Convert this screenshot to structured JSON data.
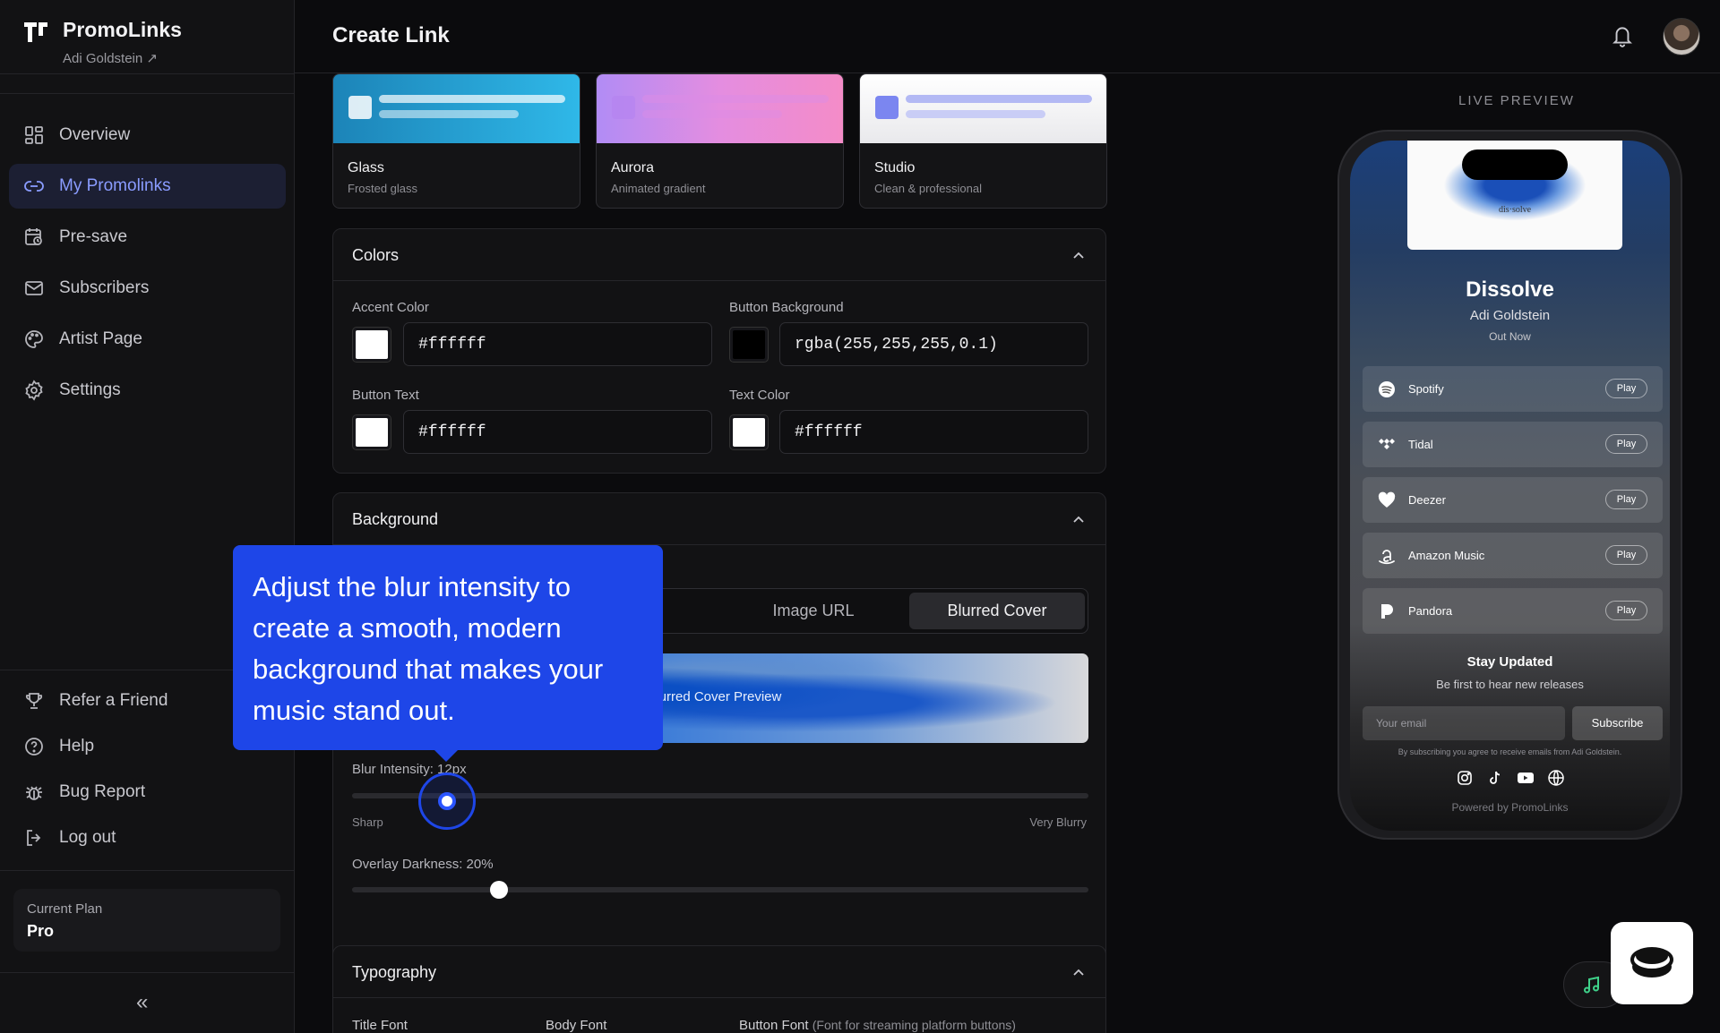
{
  "brand": {
    "name": "PromoLinks",
    "user": "Adi Goldstein ↗"
  },
  "nav": {
    "items": [
      {
        "label": "Overview",
        "icon": "grid-icon",
        "active": false
      },
      {
        "label": "My Promolinks",
        "icon": "link-icon",
        "active": true
      },
      {
        "label": "Pre-save",
        "icon": "calendar-clock-icon",
        "active": false
      },
      {
        "label": "Subscribers",
        "icon": "mail-icon",
        "active": false
      },
      {
        "label": "Artist Page",
        "icon": "palette-icon",
        "active": false
      },
      {
        "label": "Settings",
        "icon": "gear-icon",
        "active": false
      }
    ],
    "secondary": [
      {
        "label": "Refer a Friend",
        "icon": "trophy-icon"
      },
      {
        "label": "Help",
        "icon": "help-icon"
      },
      {
        "label": "Bug Report",
        "icon": "bug-icon"
      },
      {
        "label": "Log out",
        "icon": "logout-icon"
      }
    ]
  },
  "plan": {
    "label": "Current Plan",
    "value": "Pro"
  },
  "collapse_glyph": "«",
  "header": {
    "title": "Create Link"
  },
  "themes": [
    {
      "name": "Glass",
      "desc": "Frosted glass"
    },
    {
      "name": "Aurora",
      "desc": "Animated gradient"
    },
    {
      "name": "Studio",
      "desc": "Clean & professional"
    }
  ],
  "colors": {
    "title": "Colors",
    "accent": {
      "label": "Accent Color",
      "value": "#ffffff",
      "swatch": "#ffffff"
    },
    "button_bg": {
      "label": "Button Background",
      "value": "rgba(255,255,255,0.1)",
      "swatch": "#000000"
    },
    "button_text": {
      "label": "Button Text",
      "value": "#ffffff",
      "swatch": "#ffffff"
    },
    "text_color": {
      "label": "Text Color",
      "value": "#ffffff",
      "swatch": "#ffffff"
    }
  },
  "background": {
    "title": "Background",
    "options": [
      "Image URL",
      "Blurred Cover"
    ],
    "selected": "Blurred Cover",
    "preview_text": "urred Cover Preview",
    "blur": {
      "label": "Blur Intensity: 12px",
      "min_label": "Sharp",
      "max_label": "Very Blurry",
      "value_fraction": 0.13
    },
    "overlay": {
      "label": "Overlay Darkness: 20%",
      "value_fraction": 0.2
    }
  },
  "typography": {
    "title": "Typography",
    "title_font": "Title Font",
    "body_font": "Body Font",
    "button_font": "Button Font",
    "button_font_hint": "(Font for streaming platform buttons)"
  },
  "tooltip": {
    "text": "Adjust the blur intensity to create a smooth, modern background that makes your music stand out."
  },
  "preview": {
    "label": "LIVE PREVIEW",
    "cover_text": "dis·solve",
    "title": "Dissolve",
    "artist": "Adi Goldstein",
    "status": "Out Now",
    "services": [
      {
        "name": "Spotify",
        "icon": "spotify-icon",
        "cta": "Play"
      },
      {
        "name": "Tidal",
        "icon": "tidal-icon",
        "cta": "Play"
      },
      {
        "name": "Deezer",
        "icon": "deezer-icon",
        "cta": "Play"
      },
      {
        "name": "Amazon Music",
        "icon": "amazon-icon",
        "cta": "Play"
      },
      {
        "name": "Pandora",
        "icon": "pandora-icon",
        "cta": "Play"
      }
    ],
    "stay_title": "Stay Updated",
    "stay_sub": "Be first to hear new releases",
    "email_placeholder": "Your email",
    "subscribe": "Subscribe",
    "terms": "By subscribing you agree to receive emails from Adi Goldstein.",
    "powered": "Powered by PromoLinks"
  }
}
